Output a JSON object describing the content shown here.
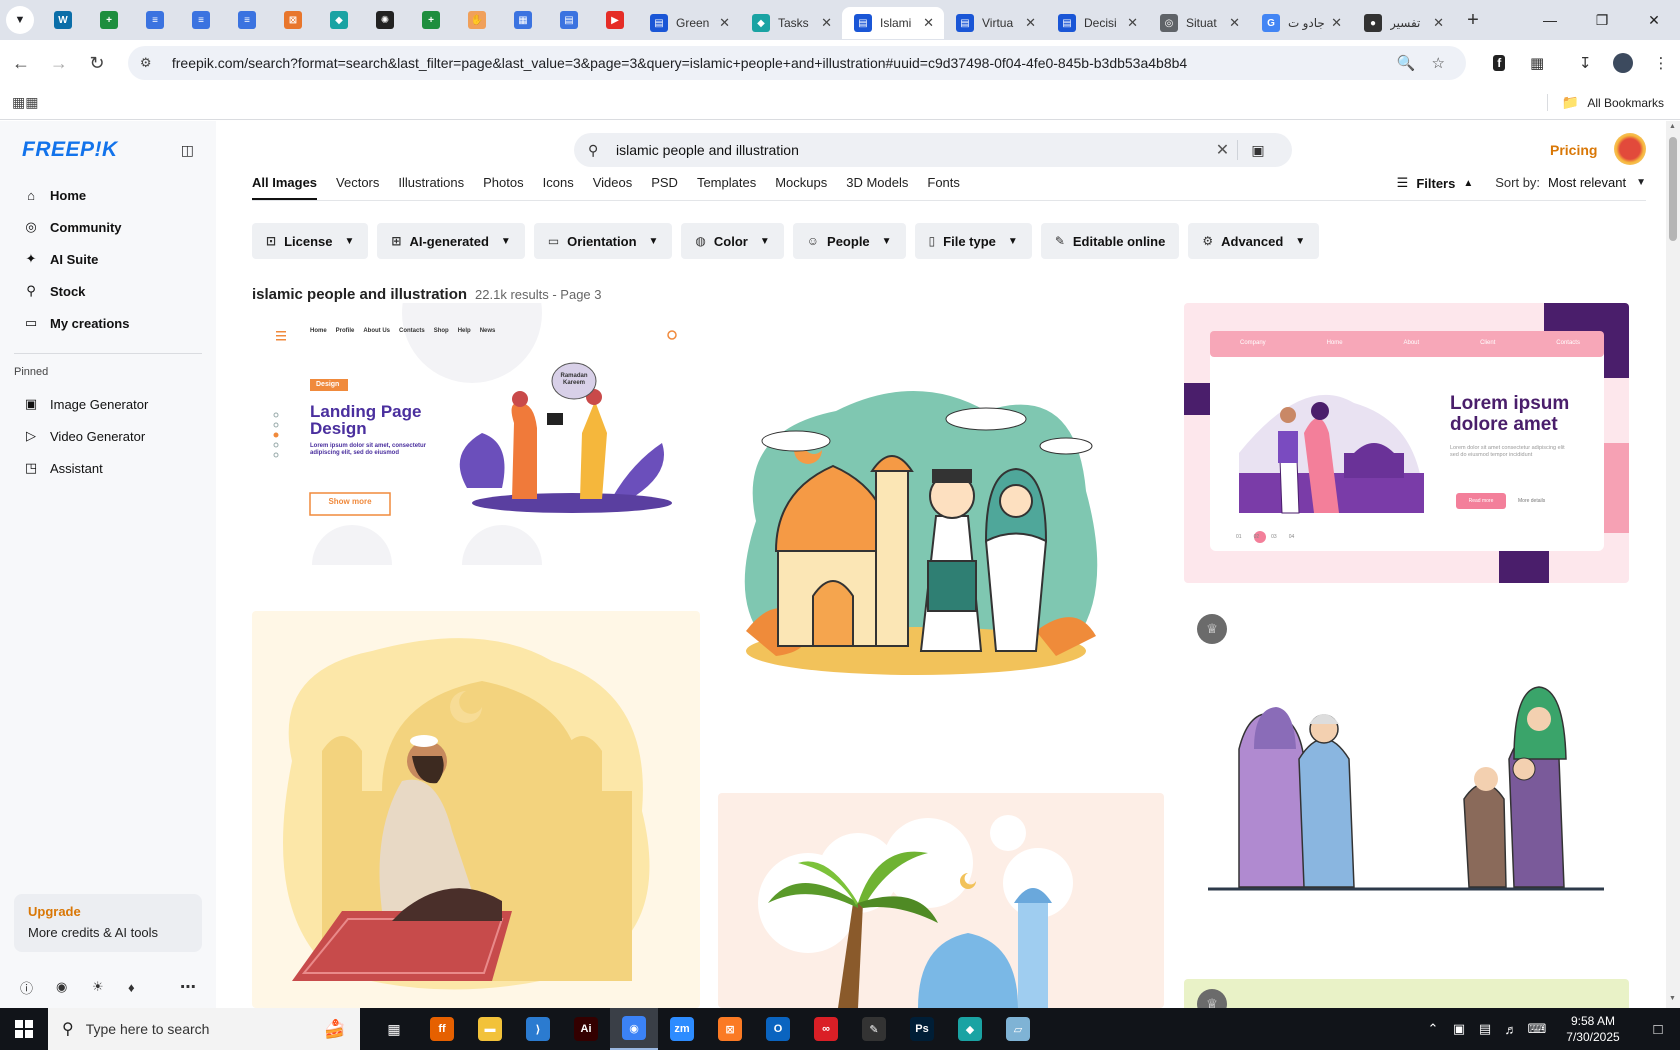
{
  "browser": {
    "pinned_tabs": [
      {
        "icon": "wordpress-icon",
        "color": "#0b6ea8"
      },
      {
        "icon": "sheets-icon",
        "color": "#1e8e3e"
      },
      {
        "icon": "docs-icon",
        "color": "#3b73e0"
      },
      {
        "icon": "docs-icon",
        "color": "#3b73e0"
      },
      {
        "icon": "docs-icon",
        "color": "#3b73e0"
      },
      {
        "icon": "flowchart-icon",
        "color": "#e8762c"
      },
      {
        "icon": "app-icon",
        "color": "#1aa3a3"
      },
      {
        "icon": "chatgpt-icon",
        "color": "#222222"
      },
      {
        "icon": "sheets-icon",
        "color": "#1e8e3e"
      },
      {
        "icon": "hand-icon",
        "color": "#f0a05a"
      },
      {
        "icon": "grid-icon",
        "color": "#3b73e0"
      },
      {
        "icon": "forms-icon",
        "color": "#3b73e0"
      },
      {
        "icon": "youtube-icon",
        "color": "#e52d27"
      }
    ],
    "tabs": [
      {
        "label": "Green",
        "icon": "forms-icon",
        "color": "#1a56d6",
        "active": false
      },
      {
        "label": "Tasks",
        "icon": "app-icon",
        "color": "#1aa3a3",
        "active": false
      },
      {
        "label": "Islami",
        "icon": "forms-icon",
        "color": "#1a56d6",
        "active": true
      },
      {
        "label": "Virtua",
        "icon": "forms-icon",
        "color": "#1a56d6",
        "active": false
      },
      {
        "label": "Decisi",
        "icon": "forms-icon",
        "color": "#1a56d6",
        "active": false
      },
      {
        "label": "Situat",
        "icon": "globe-icon",
        "color": "#5f6368",
        "active": false
      },
      {
        "label": "جادو ت",
        "icon": "google-icon",
        "color": "#4285f4",
        "active": false
      },
      {
        "label": "تفسير",
        "icon": "site-icon",
        "color": "#333333",
        "active": false
      }
    ],
    "url": "freepik.com/search?format=search&last_filter=page&last_value=3&page=3&query=islamic+people+and+illustration#uuid=c9d37498-0f04-4fe0-845b-b3db53a4b8b4",
    "all_bookmarks": "All Bookmarks"
  },
  "sidebar": {
    "logo": "FREEP!K",
    "nav": [
      {
        "label": "Home",
        "icon": "home-icon"
      },
      {
        "label": "Community",
        "icon": "globe-icon"
      },
      {
        "label": "AI Suite",
        "icon": "sparkle-icon"
      },
      {
        "label": "Stock",
        "icon": "search-icon"
      },
      {
        "label": "My creations",
        "icon": "folder-icon"
      }
    ],
    "pinned_label": "Pinned",
    "pinned": [
      {
        "label": "Image Generator",
        "icon": "image-icon"
      },
      {
        "label": "Video Generator",
        "icon": "video-icon"
      },
      {
        "label": "Assistant",
        "icon": "assistant-icon"
      }
    ],
    "upgrade_title": "Upgrade",
    "upgrade_sub": "More credits & AI tools"
  },
  "header": {
    "search_value": "islamic people and illustration",
    "pricing": "Pricing"
  },
  "type_tabs": [
    "All Images",
    "Vectors",
    "Illustrations",
    "Photos",
    "Icons",
    "Videos",
    "PSD",
    "Templates",
    "Mockups",
    "3D Models",
    "Fonts"
  ],
  "filters_label": "Filters",
  "sort_label": "Sort by:",
  "sort_value": "Most relevant",
  "filter_chips": [
    {
      "label": "License",
      "icon": "license-icon",
      "dropdown": true
    },
    {
      "label": "AI-generated",
      "icon": "ai-icon",
      "dropdown": true
    },
    {
      "label": "Orientation",
      "icon": "orientation-icon",
      "dropdown": true
    },
    {
      "label": "Color",
      "icon": "palette-icon",
      "dropdown": true
    },
    {
      "label": "People",
      "icon": "people-icon",
      "dropdown": true
    },
    {
      "label": "File type",
      "icon": "file-icon",
      "dropdown": true
    },
    {
      "label": "Editable online",
      "icon": "pen-icon",
      "dropdown": false
    },
    {
      "label": "Advanced",
      "icon": "gear-icon",
      "dropdown": true
    }
  ],
  "results": {
    "title": "islamic people and illustration",
    "meta": "22.1k results - Page 3"
  },
  "tiles": {
    "landing": {
      "nav": [
        "Home",
        "Profile",
        "About Us",
        "Contacts",
        "Shop",
        "Help",
        "News"
      ],
      "tag": "Design",
      "heading": "Landing Page Design",
      "body": "Lorem ipsum dolor sit amet, consectetur adipiscing elit, sed do eiusmod",
      "button": "Show more",
      "bubble": "Ramadan Kareem"
    },
    "lorem": {
      "heading": "Lorem ipsum dolore amet",
      "nav": [
        "Company",
        "Home",
        "About",
        "Client",
        "Contacts"
      ],
      "body": "Lorem dolor sit amet consectetur adipiscing elit sed do eiusmod tempor incididunt",
      "button": "Read more",
      "link": "More details",
      "pager": [
        "01",
        "02",
        "03",
        "04"
      ]
    }
  },
  "taskbar": {
    "search_placeholder": "Type here to search",
    "apps": [
      "firefox-icon",
      "file-explorer-icon",
      "vscode-icon",
      "illustrator-icon",
      "chrome-icon",
      "zoom-icon",
      "xampp-icon",
      "outlook-icon",
      "creative-cloud-icon",
      "pen-tool-icon",
      "photoshop-icon",
      "app-icon",
      "notepad-icon"
    ],
    "time": "9:58 AM",
    "date": "7/30/2025"
  }
}
